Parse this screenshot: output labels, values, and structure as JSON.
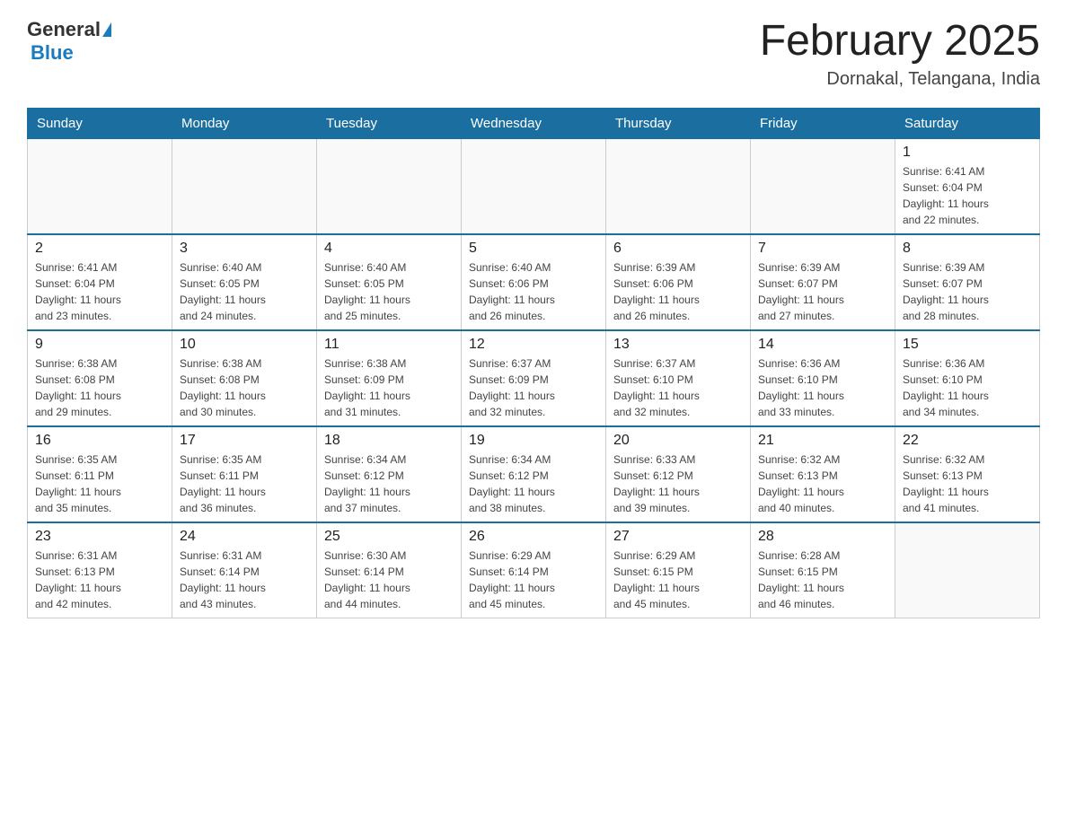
{
  "header": {
    "logo_general": "General",
    "logo_blue": "Blue",
    "title": "February 2025",
    "subtitle": "Dornakal, Telangana, India"
  },
  "days_of_week": [
    "Sunday",
    "Monday",
    "Tuesday",
    "Wednesday",
    "Thursday",
    "Friday",
    "Saturday"
  ],
  "weeks": [
    [
      {
        "day": "",
        "info": ""
      },
      {
        "day": "",
        "info": ""
      },
      {
        "day": "",
        "info": ""
      },
      {
        "day": "",
        "info": ""
      },
      {
        "day": "",
        "info": ""
      },
      {
        "day": "",
        "info": ""
      },
      {
        "day": "1",
        "info": "Sunrise: 6:41 AM\nSunset: 6:04 PM\nDaylight: 11 hours\nand 22 minutes."
      }
    ],
    [
      {
        "day": "2",
        "info": "Sunrise: 6:41 AM\nSunset: 6:04 PM\nDaylight: 11 hours\nand 23 minutes."
      },
      {
        "day": "3",
        "info": "Sunrise: 6:40 AM\nSunset: 6:05 PM\nDaylight: 11 hours\nand 24 minutes."
      },
      {
        "day": "4",
        "info": "Sunrise: 6:40 AM\nSunset: 6:05 PM\nDaylight: 11 hours\nand 25 minutes."
      },
      {
        "day": "5",
        "info": "Sunrise: 6:40 AM\nSunset: 6:06 PM\nDaylight: 11 hours\nand 26 minutes."
      },
      {
        "day": "6",
        "info": "Sunrise: 6:39 AM\nSunset: 6:06 PM\nDaylight: 11 hours\nand 26 minutes."
      },
      {
        "day": "7",
        "info": "Sunrise: 6:39 AM\nSunset: 6:07 PM\nDaylight: 11 hours\nand 27 minutes."
      },
      {
        "day": "8",
        "info": "Sunrise: 6:39 AM\nSunset: 6:07 PM\nDaylight: 11 hours\nand 28 minutes."
      }
    ],
    [
      {
        "day": "9",
        "info": "Sunrise: 6:38 AM\nSunset: 6:08 PM\nDaylight: 11 hours\nand 29 minutes."
      },
      {
        "day": "10",
        "info": "Sunrise: 6:38 AM\nSunset: 6:08 PM\nDaylight: 11 hours\nand 30 minutes."
      },
      {
        "day": "11",
        "info": "Sunrise: 6:38 AM\nSunset: 6:09 PM\nDaylight: 11 hours\nand 31 minutes."
      },
      {
        "day": "12",
        "info": "Sunrise: 6:37 AM\nSunset: 6:09 PM\nDaylight: 11 hours\nand 32 minutes."
      },
      {
        "day": "13",
        "info": "Sunrise: 6:37 AM\nSunset: 6:10 PM\nDaylight: 11 hours\nand 32 minutes."
      },
      {
        "day": "14",
        "info": "Sunrise: 6:36 AM\nSunset: 6:10 PM\nDaylight: 11 hours\nand 33 minutes."
      },
      {
        "day": "15",
        "info": "Sunrise: 6:36 AM\nSunset: 6:10 PM\nDaylight: 11 hours\nand 34 minutes."
      }
    ],
    [
      {
        "day": "16",
        "info": "Sunrise: 6:35 AM\nSunset: 6:11 PM\nDaylight: 11 hours\nand 35 minutes."
      },
      {
        "day": "17",
        "info": "Sunrise: 6:35 AM\nSunset: 6:11 PM\nDaylight: 11 hours\nand 36 minutes."
      },
      {
        "day": "18",
        "info": "Sunrise: 6:34 AM\nSunset: 6:12 PM\nDaylight: 11 hours\nand 37 minutes."
      },
      {
        "day": "19",
        "info": "Sunrise: 6:34 AM\nSunset: 6:12 PM\nDaylight: 11 hours\nand 38 minutes."
      },
      {
        "day": "20",
        "info": "Sunrise: 6:33 AM\nSunset: 6:12 PM\nDaylight: 11 hours\nand 39 minutes."
      },
      {
        "day": "21",
        "info": "Sunrise: 6:32 AM\nSunset: 6:13 PM\nDaylight: 11 hours\nand 40 minutes."
      },
      {
        "day": "22",
        "info": "Sunrise: 6:32 AM\nSunset: 6:13 PM\nDaylight: 11 hours\nand 41 minutes."
      }
    ],
    [
      {
        "day": "23",
        "info": "Sunrise: 6:31 AM\nSunset: 6:13 PM\nDaylight: 11 hours\nand 42 minutes."
      },
      {
        "day": "24",
        "info": "Sunrise: 6:31 AM\nSunset: 6:14 PM\nDaylight: 11 hours\nand 43 minutes."
      },
      {
        "day": "25",
        "info": "Sunrise: 6:30 AM\nSunset: 6:14 PM\nDaylight: 11 hours\nand 44 minutes."
      },
      {
        "day": "26",
        "info": "Sunrise: 6:29 AM\nSunset: 6:14 PM\nDaylight: 11 hours\nand 45 minutes."
      },
      {
        "day": "27",
        "info": "Sunrise: 6:29 AM\nSunset: 6:15 PM\nDaylight: 11 hours\nand 45 minutes."
      },
      {
        "day": "28",
        "info": "Sunrise: 6:28 AM\nSunset: 6:15 PM\nDaylight: 11 hours\nand 46 minutes."
      },
      {
        "day": "",
        "info": ""
      }
    ]
  ]
}
